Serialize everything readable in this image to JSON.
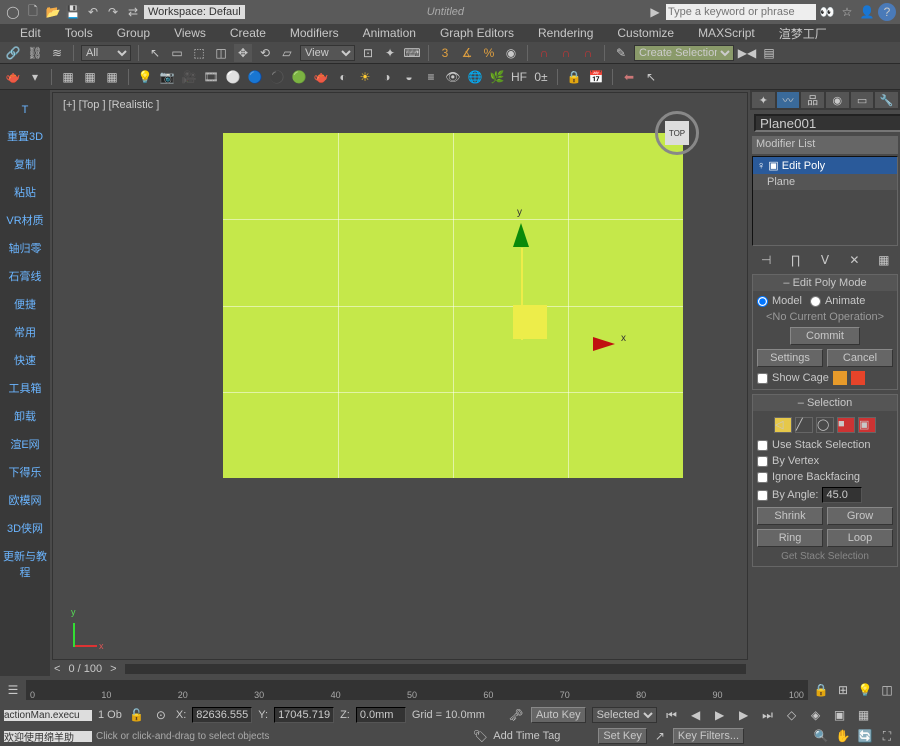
{
  "top": {
    "workspace_label": "Workspace: Defaul",
    "title": "Untitled",
    "search_placeholder": "Type a keyword or phrase"
  },
  "menu": [
    "Edit",
    "Tools",
    "Group",
    "Views",
    "Create",
    "Modifiers",
    "Animation",
    "Graph Editors",
    "Rendering",
    "Customize",
    "MAXScript",
    "渲梦工厂"
  ],
  "toolbar2": {
    "all_label": "All",
    "view_label": "View",
    "sel_set_label": "Create Selection Se"
  },
  "left": [
    "T",
    "重置3D",
    "复制",
    "粘贴",
    "VR材质",
    "轴归零",
    "石膏线",
    "便捷",
    "常用",
    "快速",
    "工具箱",
    "卸载",
    "渲E网",
    "下得乐",
    "欧模网",
    "3D侠网",
    "更新与教程"
  ],
  "viewport": {
    "label": "[+] [Top ] [Realistic ]",
    "cube_face": "TOP",
    "axis_x": "x",
    "axis_y": "y"
  },
  "right": {
    "obj_name": "Plane001",
    "mod_list": "Modifier List",
    "stack": {
      "edit_poly": "Edit Poly",
      "plane": "Plane"
    },
    "epm": {
      "title": "Edit Poly Mode",
      "model": "Model",
      "animate": "Animate",
      "noop": "<No Current Operation>",
      "commit": "Commit",
      "settings": "Settings",
      "cancel": "Cancel",
      "show_cage": "Show Cage"
    },
    "sel": {
      "title": "Selection",
      "use_stack": "Use Stack Selection",
      "by_vertex": "By Vertex",
      "ignore_bf": "Ignore Backfacing",
      "by_angle": "By Angle:",
      "angle": "45.0",
      "shrink": "Shrink",
      "grow": "Grow",
      "ring": "Ring",
      "loop": "Loop",
      "getstack": "Get Stack Selection"
    }
  },
  "time": {
    "frame": "0 / 100",
    "ticks": [
      "0",
      "10",
      "20",
      "30",
      "40",
      "50",
      "60",
      "70",
      "80",
      "90",
      "100"
    ]
  },
  "status": {
    "objcount": "1 Ob",
    "x_label": "X:",
    "x": "82636.555",
    "y_label": "Y:",
    "y": "17045.719",
    "z_label": "Z:",
    "z": "0.0mm",
    "grid": "Grid = 10.0mm",
    "autokey": "Auto Key",
    "selected": "Selected",
    "setkey": "Set Key",
    "keyfilters": "Key Filters...",
    "add_tag": "Add Time Tag",
    "cmd1": "actionMan.execu",
    "cmd2": "欢迎使用绵羊助",
    "hint": "Click or click-and-drag to select objects"
  }
}
